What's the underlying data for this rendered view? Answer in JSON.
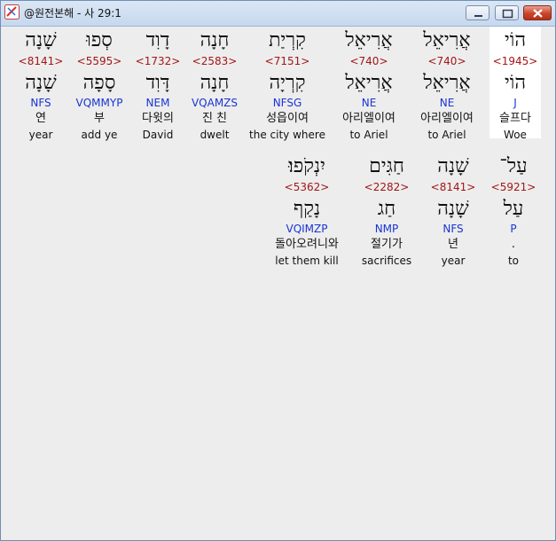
{
  "window": {
    "title": "@원전본해 - 사 29:1"
  },
  "words": [
    {
      "heb": "הוֹי",
      "strong": "<1945>",
      "heb2": "הוֹי",
      "morph": "J",
      "kor": "슬프다",
      "eng": "Woe"
    },
    {
      "heb": "אֲרִיאֵל",
      "strong": "<740>",
      "heb2": "אֲרִיאֵל",
      "morph": "NE",
      "kor": "아리엘이여",
      "eng": "to Ariel"
    },
    {
      "heb": "אֲרִיאֵל",
      "strong": "<740>",
      "heb2": "אֲרִיאֵל",
      "morph": "NE",
      "kor": "아리엘이여",
      "eng": "to Ariel"
    },
    {
      "heb": "קִרְיַת",
      "strong": "<7151>",
      "heb2": "קִרְיָה",
      "morph": "NFSG",
      "kor": "성읍이여",
      "eng": "the city where"
    },
    {
      "heb": "חָנָה",
      "strong": "<2583>",
      "heb2": "חָנָה",
      "morph": "VQAMZS",
      "kor": "진 친",
      "eng": "dwelt"
    },
    {
      "heb": "דָוִד",
      "strong": "<1732>",
      "heb2": "דָּוִד",
      "morph": "NEM",
      "kor": "다윗의",
      "eng": "David"
    },
    {
      "heb": "סְפוּ",
      "strong": "<5595>",
      "heb2": "סָפָה",
      "morph": "VQMMYP",
      "kor": "부",
      "eng": "add ye"
    },
    {
      "heb": "שָׁנָה",
      "strong": "<8141>",
      "heb2": "שָׁנָה",
      "morph": "NFS",
      "kor": "연",
      "eng": "year"
    },
    {
      "heb": "עַל־",
      "strong": "<5921>",
      "heb2": "עַל",
      "morph": "P",
      "kor": ".",
      "eng": "to"
    },
    {
      "heb": "שָׁנָה",
      "strong": "<8141>",
      "heb2": "שָׁנָה",
      "morph": "NFS",
      "kor": "년",
      "eng": "year"
    },
    {
      "heb": "חַגִּים",
      "strong": "<2282>",
      "heb2": "חַג",
      "morph": "NMP",
      "kor": "절기가",
      "eng": "sacrifices"
    },
    {
      "heb": "יִנְקֹפוּ׃",
      "strong": "<5362>",
      "heb2": "נָקַף",
      "morph": "VQIMZP",
      "kor": "돌아오려니와",
      "eng": "let them kill"
    }
  ]
}
